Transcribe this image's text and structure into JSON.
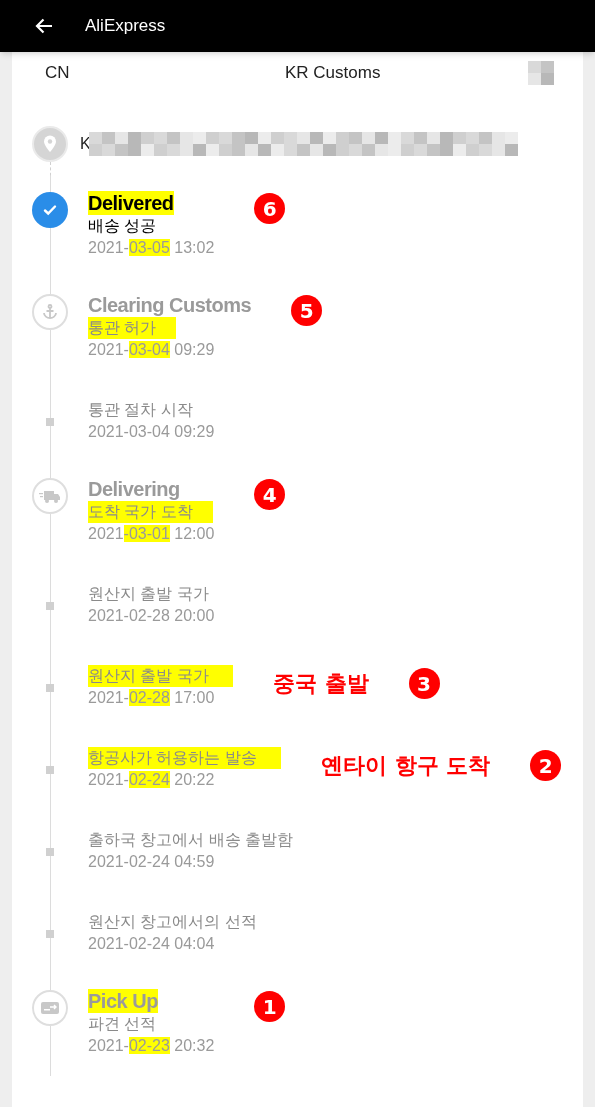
{
  "app_bar": {
    "title": "AliExpress"
  },
  "route": {
    "origin": "CN",
    "checkpoint": "KR Customs"
  },
  "address": {
    "visible_text": "K"
  },
  "events": [
    {
      "kind": "milestone",
      "done": true,
      "title": "Delivered",
      "title_highlight": true,
      "description": "배송 성공",
      "description_highlight": false,
      "date": [
        {
          "text": "2021-",
          "highlight": false
        },
        {
          "text": "03-05",
          "highlight": true
        },
        {
          "text": " 13:02",
          "highlight": false
        }
      ],
      "annotation": {
        "number": "6"
      }
    },
    {
      "kind": "milestone",
      "done": false,
      "title": "Clearing Customs",
      "title_highlight": false,
      "description": "통관 허가",
      "description_highlight": true,
      "date": [
        {
          "text": "2021-",
          "highlight": false
        },
        {
          "text": "03-04",
          "highlight": true
        },
        {
          "text": " 09:29",
          "highlight": false
        }
      ],
      "annotation": {
        "number": "5"
      }
    },
    {
      "kind": "step",
      "description": "통관 절차 시작",
      "description_highlight": false,
      "date": [
        {
          "text": "2021-03-04 09:29",
          "highlight": false
        }
      ]
    },
    {
      "kind": "milestone",
      "done": false,
      "title": "Delivering",
      "title_highlight": false,
      "description": "도착 국가 도착",
      "description_highlight": true,
      "date": [
        {
          "text": "2021",
          "highlight": false
        },
        {
          "text": "-03-01",
          "highlight": true
        },
        {
          "text": " 12:00",
          "highlight": false
        }
      ],
      "annotation": {
        "number": "4"
      }
    },
    {
      "kind": "step",
      "description": "원산지 출발 국가",
      "description_highlight": false,
      "date": [
        {
          "text": "2021-02-28 20:00",
          "highlight": false
        }
      ]
    },
    {
      "kind": "step",
      "description": "원산지 출발 국가",
      "description_highlight": true,
      "date": [
        {
          "text": "2021-",
          "highlight": false
        },
        {
          "text": "02-28",
          "highlight": true
        },
        {
          "text": " 17:00",
          "highlight": false
        }
      ],
      "annotation": {
        "note": "중국 출발",
        "number": "3"
      }
    },
    {
      "kind": "step",
      "description": "항공사가 허용하는 발송",
      "description_highlight": true,
      "date": [
        {
          "text": "2021-",
          "highlight": false
        },
        {
          "text": "02-24",
          "highlight": true
        },
        {
          "text": " 20:22",
          "highlight": false
        }
      ],
      "annotation": {
        "note": "옌타이 항구 도착",
        "number": "2"
      }
    },
    {
      "kind": "step",
      "description": "출하국 창고에서 배송 출발함",
      "description_highlight": false,
      "date": [
        {
          "text": "2021-02-24 04:59",
          "highlight": false
        }
      ]
    },
    {
      "kind": "step",
      "description": "원산지 창고에서의 선적",
      "description_highlight": false,
      "date": [
        {
          "text": "2021-02-24 04:04",
          "highlight": false
        }
      ]
    },
    {
      "kind": "milestone",
      "done": false,
      "title": "Pick Up",
      "title_highlight": true,
      "description": "파견 선적",
      "description_highlight": false,
      "date": [
        {
          "text": "2021-",
          "highlight": false
        },
        {
          "text": "02-23",
          "highlight": true
        },
        {
          "text": " 20:32",
          "highlight": false
        }
      ],
      "annotation": {
        "number": "1"
      }
    }
  ]
}
